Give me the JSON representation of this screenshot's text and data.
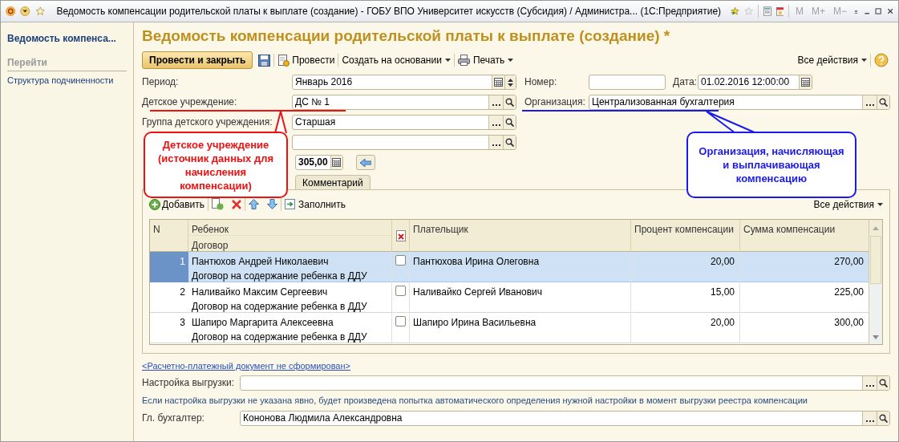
{
  "window": {
    "title": "Ведомость компенсации родительской платы к выплате (создание) - ГОБУ ВПО Университет искусств (Субсидия) / Администра...  (1С:Предприятие)",
    "memory_buttons": [
      "M",
      "M+",
      "M−"
    ]
  },
  "sidebar": {
    "title": "Ведомость компенса...",
    "section": "Перейти",
    "items": [
      {
        "label": "Структура подчиненности"
      }
    ]
  },
  "form": {
    "title": "Ведомость компенсации родительской платы к выплате (создание) *",
    "toolbar": {
      "primary": "Провести и закрыть",
      "post": "Провести",
      "create_based": "Создать на основании",
      "print": "Печать",
      "all_actions": "Все действия"
    },
    "period": {
      "label": "Период:",
      "value": "Январь 2016"
    },
    "number": {
      "label": "Номер:"
    },
    "date": {
      "label": "Дата:",
      "value": "01.02.2016 12:00:00"
    },
    "institution": {
      "label": "Детское учреждение:",
      "value": "ДС № 1"
    },
    "organization": {
      "label": "Организация:",
      "value": "Централизованная бухгалтерия"
    },
    "group": {
      "label": "Группа детского учреждения:",
      "value": "Старшая"
    },
    "total": {
      "value": "305,00"
    },
    "tabs": [
      {
        "label": "Комментарий",
        "selected": false
      }
    ]
  },
  "table": {
    "toolbar": {
      "add": "Добавить",
      "fill": "Заполнить",
      "all_actions": "Все действия"
    },
    "columns": {
      "n": "N",
      "child": "Ребенок",
      "contract": "Договор",
      "payer": "Плательщик",
      "percent": "Процент компенсации",
      "sum": "Сумма компенсации"
    },
    "rows": [
      {
        "n": "1",
        "child": "Пантюхов Андрей Николаевич",
        "contract": "Договор на содержание ребенка в ДДУ",
        "checked": false,
        "payer": "Пантюхова Ирина Олеговна",
        "percent": "20,00",
        "sum": "270,00",
        "selected": true
      },
      {
        "n": "2",
        "child": "Наливайко Максим Сергеевич",
        "contract": "Договор на содержание ребенка в ДДУ",
        "checked": false,
        "payer": "Наливайко Сергей Иванович",
        "percent": "15,00",
        "sum": "225,00",
        "selected": false
      },
      {
        "n": "3",
        "child": "Шапиро Маргарита Алексеевна",
        "contract": "Договор на содержание ребенка в ДДУ",
        "checked": false,
        "payer": "Шапиро Ирина Васильевна",
        "percent": "20,00",
        "sum": "300,00",
        "selected": false
      }
    ]
  },
  "payment_link": "<Расчетно-платежный документ не сформирован>",
  "export_setting": {
    "label": "Настройка выгрузки:"
  },
  "hint": "Если настройка выгрузки не указана явно, будет произведена попытка автоматического определения нужной настройки в момент выгрузки реестра компенсации",
  "chief_accountant": {
    "label": "Гл. бухгалтер:",
    "value": "Кононова Людмила Александровна"
  },
  "callouts": [
    {
      "text": "Детское учреждение (источник данных для начисления компенсации)",
      "color": "#ee1111"
    },
    {
      "text": "Организация, начисляющая и выплачивающая компенсацию",
      "color": "#1a1aee"
    }
  ]
}
